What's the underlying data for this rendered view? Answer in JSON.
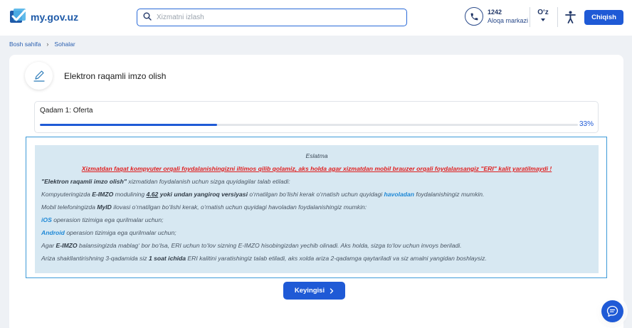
{
  "header": {
    "logo_text": "my.gov.uz",
    "search_placeholder": "Xizmatni izlash",
    "contact_number": "1242",
    "contact_label": "Aloqa markazi",
    "language": "O‘z",
    "logout_label": "Chiqish"
  },
  "breadcrumb": {
    "home": "Bosh sahifa",
    "current": "Sohalar"
  },
  "service": {
    "title": "Elektron raqamli imzo olish"
  },
  "step": {
    "title": "Qadam 1: Oferta",
    "progress_percent": 33,
    "progress_label": "33%"
  },
  "notice": {
    "title": "Eslatma",
    "warning": "Xizmatdan faqat kompyuter orqali foydalanishingizni iltimos qilib qolamiz, aks holda agar xizmatdan mobil brauzer orqali foydalansangiz \"ERI\" kalit yaratilmaydi !",
    "l1_bold": "\"Elektron raqamli imzo olish\"",
    "l1_text": " xizmatidan foydalanish uchun sizga quyidagilar talab etiladi:",
    "l2_a": "Kompyuteringizda ",
    "l2_b": "E-IMZO",
    "l2_c": " modulining ",
    "l2_d": "4.62",
    "l2_e": " yoki undan yangiroq versiyasi",
    "l2_f": " o‘rnatilgan bo‘lishi kerak o‘rnatish uchun quyidagi ",
    "l2_link": "havoladan",
    "l2_g": " foydalanishingiz mumkin.",
    "l3_a": "Mobil telefoningizda ",
    "l3_b": "MyID",
    "l3_c": " ilovasi o‘rnatilgan bo‘lishi kerak, o‘rnatish uchun quyidagi havoladan foydalanishingiz mumkin:",
    "l4_link": "iOS",
    "l4_text": " operasion tizimiga ega qurilmalar uchun;",
    "l5_link": "Android",
    "l5_text": " operasion tizimiga ega qurilmalar uchun;",
    "l6_a": "Agar ",
    "l6_b": "E-IMZO",
    "l6_c": " balansingizda mablag‘ bor bo‘lsa, ERI uchun to‘lov sizning E-IMZO hisobingizdan yechib olinadi. Aks holda, sizga to‘lov uchun invoys beriladi.",
    "l7_a": "Ariza shakllantirishning 3-qadamida siz ",
    "l7_b": "1 soat ichida",
    "l7_c": " ERI kalitini yaratishingiz talab etiladi, aks xolda ariza 2-qadamga qaytariladi va siz amalni yangidan boshlaysiz."
  },
  "actions": {
    "next_label": "Keyingisi"
  },
  "icons": {
    "logo": "checkbox-logo-icon",
    "search": "search-icon",
    "phone": "phone-icon",
    "accessibility": "accessibility-icon",
    "service": "pen-sign-icon",
    "next": "chevron-right-icon",
    "chat": "chat-icon"
  },
  "colors": {
    "primary": "#1f5ad6",
    "warning": "#e01e1e",
    "link": "#1e88d6",
    "notice_bg": "#d7e8f2",
    "frame": "#3d9ad8"
  }
}
